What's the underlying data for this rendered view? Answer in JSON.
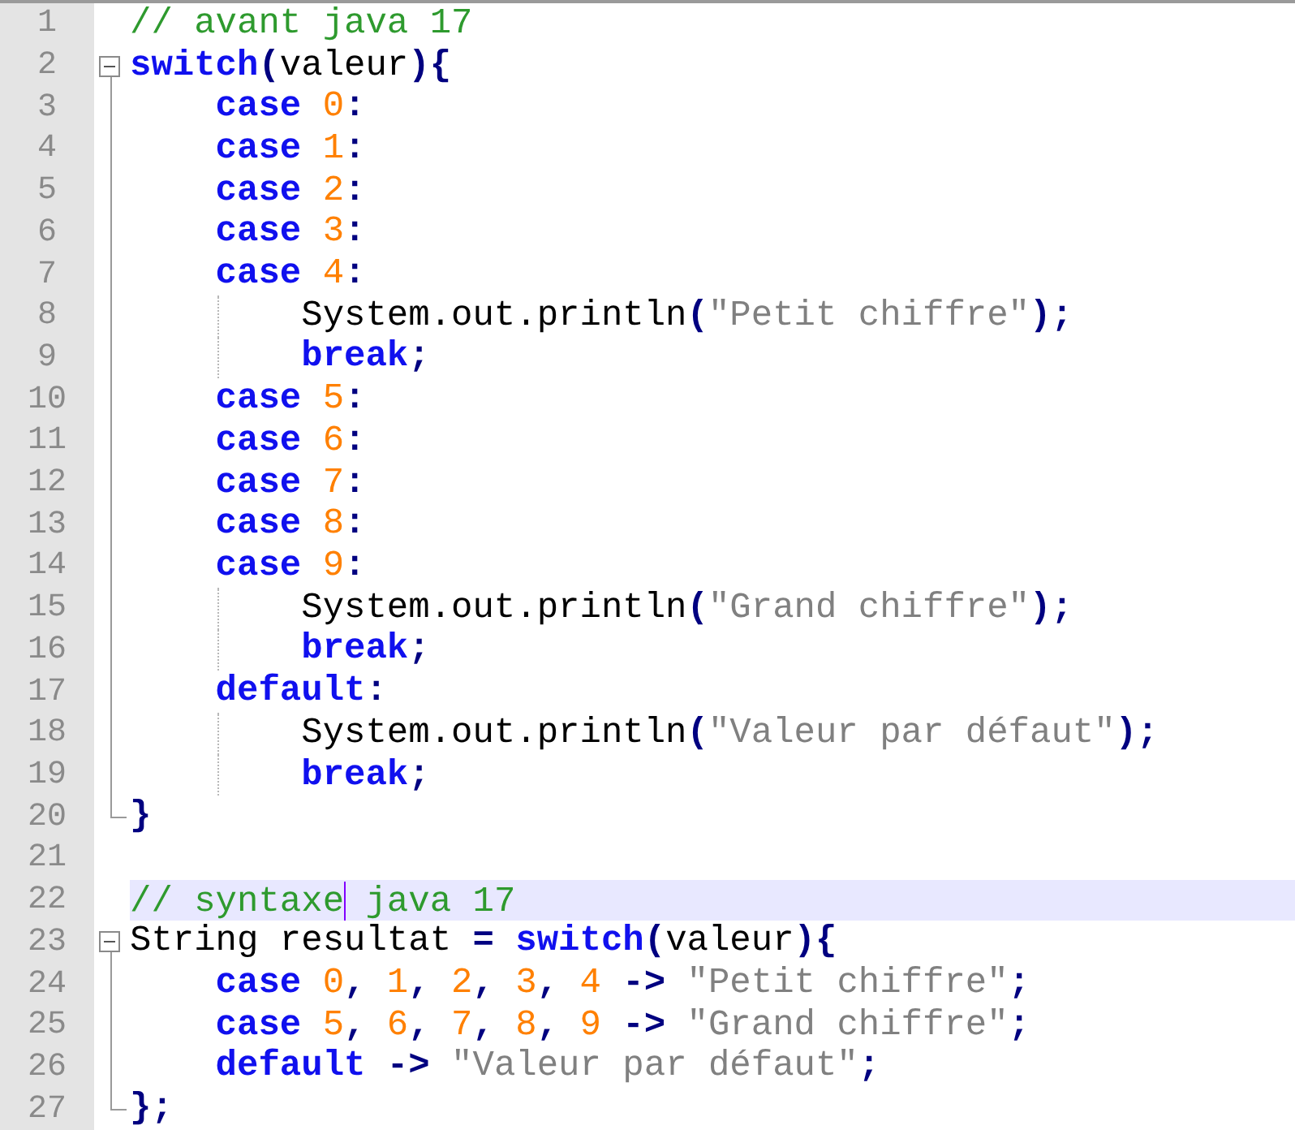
{
  "editor": {
    "lines": [
      {
        "number": "1",
        "current": false,
        "tokens": [
          {
            "kind": "comment",
            "text": "// avant java 17"
          }
        ]
      },
      {
        "number": "2",
        "fold": {
          "kind": "start"
        },
        "current": false,
        "tokens": [
          {
            "kind": "keyword",
            "text": "switch"
          },
          {
            "kind": "operator",
            "text": "("
          },
          {
            "kind": "plain",
            "text": "valeur"
          },
          {
            "kind": "operator",
            "text": "){"
          }
        ]
      },
      {
        "number": "3",
        "fold": {
          "kind": "line"
        },
        "current": false,
        "tokens": [
          {
            "kind": "keyword",
            "text": "    case"
          },
          {
            "kind": "number",
            "text": " 0"
          },
          {
            "kind": "operator",
            "text": ":"
          }
        ]
      },
      {
        "number": "4",
        "fold": {
          "kind": "line"
        },
        "current": false,
        "tokens": [
          {
            "kind": "keyword",
            "text": "    case"
          },
          {
            "kind": "number",
            "text": " 1"
          },
          {
            "kind": "operator",
            "text": ":"
          }
        ]
      },
      {
        "number": "5",
        "fold": {
          "kind": "line"
        },
        "current": false,
        "tokens": [
          {
            "kind": "keyword",
            "text": "    case"
          },
          {
            "kind": "number",
            "text": " 2"
          },
          {
            "kind": "operator",
            "text": ":"
          }
        ]
      },
      {
        "number": "6",
        "fold": {
          "kind": "line"
        },
        "current": false,
        "tokens": [
          {
            "kind": "keyword",
            "text": "    case"
          },
          {
            "kind": "number",
            "text": " 3"
          },
          {
            "kind": "operator",
            "text": ":"
          }
        ]
      },
      {
        "number": "7",
        "fold": {
          "kind": "line"
        },
        "current": false,
        "tokens": [
          {
            "kind": "keyword",
            "text": "    case"
          },
          {
            "kind": "number",
            "text": " 4"
          },
          {
            "kind": "operator",
            "text": ":"
          }
        ]
      },
      {
        "number": "8",
        "fold": {
          "kind": "line"
        },
        "current": false,
        "indent_guide": true,
        "tokens": [
          {
            "kind": "plain",
            "text": "        System.out.println"
          },
          {
            "kind": "operator",
            "text": "("
          },
          {
            "kind": "string",
            "text": "\"Petit chiffre\""
          },
          {
            "kind": "operator",
            "text": ");"
          }
        ]
      },
      {
        "number": "9",
        "fold": {
          "kind": "line"
        },
        "current": false,
        "indent_guide": true,
        "tokens": [
          {
            "kind": "keyword",
            "text": "        break"
          },
          {
            "kind": "operator",
            "text": ";"
          }
        ]
      },
      {
        "number": "10",
        "fold": {
          "kind": "line"
        },
        "current": false,
        "tokens": [
          {
            "kind": "keyword",
            "text": "    case"
          },
          {
            "kind": "number",
            "text": " 5"
          },
          {
            "kind": "operator",
            "text": ":"
          }
        ]
      },
      {
        "number": "11",
        "fold": {
          "kind": "line"
        },
        "current": false,
        "tokens": [
          {
            "kind": "keyword",
            "text": "    case"
          },
          {
            "kind": "number",
            "text": " 6"
          },
          {
            "kind": "operator",
            "text": ":"
          }
        ]
      },
      {
        "number": "12",
        "fold": {
          "kind": "line"
        },
        "current": false,
        "tokens": [
          {
            "kind": "keyword",
            "text": "    case"
          },
          {
            "kind": "number",
            "text": " 7"
          },
          {
            "kind": "operator",
            "text": ":"
          }
        ]
      },
      {
        "number": "13",
        "fold": {
          "kind": "line"
        },
        "current": false,
        "tokens": [
          {
            "kind": "keyword",
            "text": "    case"
          },
          {
            "kind": "number",
            "text": " 8"
          },
          {
            "kind": "operator",
            "text": ":"
          }
        ]
      },
      {
        "number": "14",
        "fold": {
          "kind": "line"
        },
        "current": false,
        "tokens": [
          {
            "kind": "keyword",
            "text": "    case"
          },
          {
            "kind": "number",
            "text": " 9"
          },
          {
            "kind": "operator",
            "text": ":"
          }
        ]
      },
      {
        "number": "15",
        "fold": {
          "kind": "line"
        },
        "current": false,
        "indent_guide": true,
        "tokens": [
          {
            "kind": "plain",
            "text": "        System.out.println"
          },
          {
            "kind": "operator",
            "text": "("
          },
          {
            "kind": "string",
            "text": "\"Grand chiffre\""
          },
          {
            "kind": "operator",
            "text": ");"
          }
        ]
      },
      {
        "number": "16",
        "fold": {
          "kind": "line"
        },
        "current": false,
        "indent_guide": true,
        "tokens": [
          {
            "kind": "keyword",
            "text": "        break"
          },
          {
            "kind": "operator",
            "text": ";"
          }
        ]
      },
      {
        "number": "17",
        "fold": {
          "kind": "line"
        },
        "current": false,
        "tokens": [
          {
            "kind": "keyword",
            "text": "    default"
          },
          {
            "kind": "operator",
            "text": ":"
          }
        ]
      },
      {
        "number": "18",
        "fold": {
          "kind": "line"
        },
        "current": false,
        "indent_guide": true,
        "tokens": [
          {
            "kind": "plain",
            "text": "        System.out.println"
          },
          {
            "kind": "operator",
            "text": "("
          },
          {
            "kind": "string",
            "text": "\"Valeur par défaut\""
          },
          {
            "kind": "operator",
            "text": ");"
          }
        ]
      },
      {
        "number": "19",
        "fold": {
          "kind": "line"
        },
        "current": false,
        "indent_guide": true,
        "tokens": [
          {
            "kind": "keyword",
            "text": "        break"
          },
          {
            "kind": "operator",
            "text": ";"
          }
        ]
      },
      {
        "number": "20",
        "fold": {
          "kind": "end"
        },
        "current": false,
        "tokens": [
          {
            "kind": "operator",
            "text": "}"
          }
        ]
      },
      {
        "number": "21",
        "current": false
      },
      {
        "number": "22",
        "current": true,
        "tokens": [
          {
            "kind": "comment",
            "text": "// syntaxe",
            "caret_after": true
          },
          {
            "kind": "comment",
            "text": " java 17"
          }
        ]
      },
      {
        "number": "23",
        "fold": {
          "kind": "start"
        },
        "current": false,
        "tokens": [
          {
            "kind": "plain",
            "text": "String resultat "
          },
          {
            "kind": "operator",
            "text": "="
          },
          {
            "kind": "keyword",
            "text": " switch"
          },
          {
            "kind": "operator",
            "text": "("
          },
          {
            "kind": "plain",
            "text": "valeur"
          },
          {
            "kind": "operator",
            "text": "){"
          }
        ]
      },
      {
        "number": "24",
        "fold": {
          "kind": "line"
        },
        "current": false,
        "tokens": [
          {
            "kind": "keyword",
            "text": "    case"
          },
          {
            "kind": "number",
            "text": " 0"
          },
          {
            "kind": "operator",
            "text": ","
          },
          {
            "kind": "number",
            "text": " 1"
          },
          {
            "kind": "operator",
            "text": ","
          },
          {
            "kind": "number",
            "text": " 2"
          },
          {
            "kind": "operator",
            "text": ","
          },
          {
            "kind": "number",
            "text": " 3"
          },
          {
            "kind": "operator",
            "text": ","
          },
          {
            "kind": "number",
            "text": " 4"
          },
          {
            "kind": "operator",
            "text": " ->"
          },
          {
            "kind": "string",
            "text": " \"Petit chiffre\""
          },
          {
            "kind": "operator",
            "text": ";"
          }
        ]
      },
      {
        "number": "25",
        "fold": {
          "kind": "line"
        },
        "current": false,
        "tokens": [
          {
            "kind": "keyword",
            "text": "    case"
          },
          {
            "kind": "number",
            "text": " 5"
          },
          {
            "kind": "operator",
            "text": ","
          },
          {
            "kind": "number",
            "text": " 6"
          },
          {
            "kind": "operator",
            "text": ","
          },
          {
            "kind": "number",
            "text": " 7"
          },
          {
            "kind": "operator",
            "text": ","
          },
          {
            "kind": "number",
            "text": " 8"
          },
          {
            "kind": "operator",
            "text": ","
          },
          {
            "kind": "number",
            "text": " 9"
          },
          {
            "kind": "operator",
            "text": " ->"
          },
          {
            "kind": "string",
            "text": " \"Grand chiffre\""
          },
          {
            "kind": "operator",
            "text": ";"
          }
        ]
      },
      {
        "number": "26",
        "fold": {
          "kind": "line"
        },
        "current": false,
        "tokens": [
          {
            "kind": "keyword",
            "text": "    default"
          },
          {
            "kind": "operator",
            "text": " ->"
          },
          {
            "kind": "string",
            "text": " \"Valeur par défaut\""
          },
          {
            "kind": "operator",
            "text": ";"
          }
        ]
      },
      {
        "number": "27",
        "fold": {
          "kind": "end"
        },
        "current": false,
        "tokens": [
          {
            "kind": "operator",
            "text": "};"
          }
        ]
      }
    ]
  }
}
